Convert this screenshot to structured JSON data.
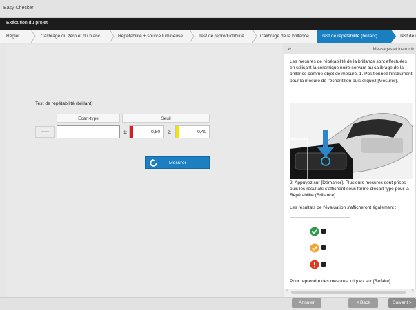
{
  "window": {
    "title": "Easy Checker"
  },
  "exec_bar": {
    "label": "Exécution du projet"
  },
  "steps": [
    {
      "label": "Régler"
    },
    {
      "label": "Calibrage du zéro et du blanc"
    },
    {
      "label": "Répétabilité + source lumineuse"
    },
    {
      "label": "Test de reproductibilité"
    },
    {
      "label": "Calibrage de la brillance"
    },
    {
      "label": "Test de répétabilité (brillant)",
      "active": true
    },
    {
      "label": "Test de r"
    }
  ],
  "main": {
    "section_title": "Test de répétabilité (brillant)",
    "col_ecart": "Ecart-type",
    "col_seuil": "Seuil",
    "dash_placeholder": "------",
    "thresholds": [
      {
        "label": "1:",
        "value": "0,80",
        "color": "#d81e1e"
      },
      {
        "label": "2:",
        "value": "0,40",
        "color": "#f2e600"
      }
    ],
    "measure_button": "Mesurer",
    "measure_icon": "refresh-icon"
  },
  "panel": {
    "collapse_glyph": "»",
    "title": "Messages et instructio",
    "p1": "Les mesures de répétabilité de la brillance sont effectuées en utilisant la céramique noire servant au calibrage de la brillance comme objet de mesure. 1. Positionnez l'instrument pour la mesure de l'échantillon puis cliquez [Mesurer].",
    "p2": "2. Appuyez sur [Démarrer]. Plusieurs mesures sont prises puis les résultats s'affichent sous forme d'écart-type pour la Répétabilité (Brillance).",
    "p3": "Les résultats de l'évaluation s'afficheront également :",
    "p4": "Pour reprendre des mesures, cliquez sur [Refaire].",
    "eval_icons": [
      "check-circle-icon",
      "check-circle-icon",
      "exclamation-circle-icon"
    ],
    "eval_colors": [
      "#2e9b4a",
      "#f3a533",
      "#e23a1f"
    ]
  },
  "footer": {
    "cancel": "Annuler",
    "back": "< Back",
    "next": "Suivant >"
  }
}
